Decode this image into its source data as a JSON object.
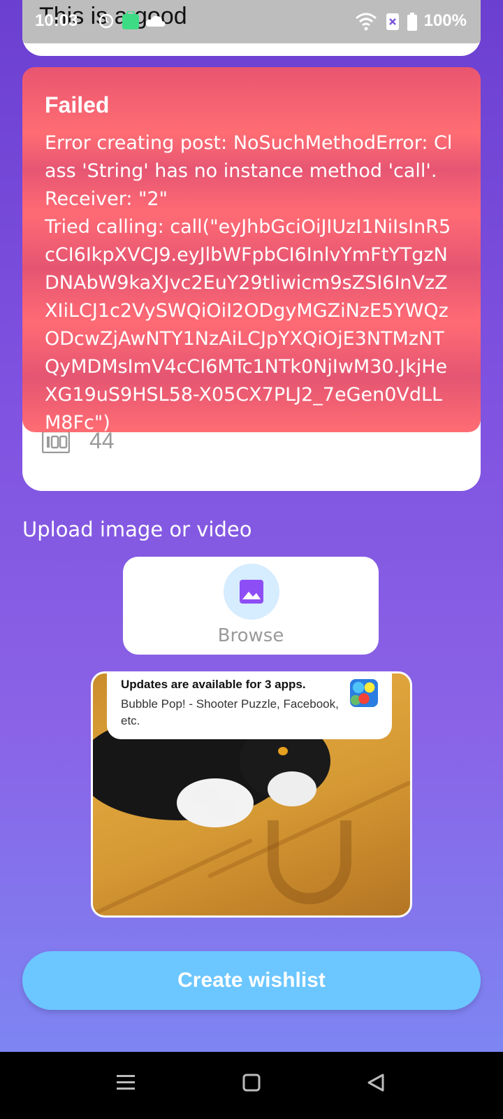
{
  "status_bar": {
    "time": "10:03",
    "battery": "100%",
    "icons": [
      "sync-icon",
      "app-store-icon",
      "cloud-icon",
      "wifi-icon",
      "sim-off-icon",
      "battery-icon"
    ]
  },
  "top_field": {
    "value": "This is a good"
  },
  "error_toast": {
    "title": "Failed",
    "message": "Error creating post: NoSuchMethodError: Class 'String' has no instance method 'call'.\nReceiver: \"2\"\nTried calling: call(\"eyJhbGciOiJIUzI1NiIsInR5cCI6IkpXVCJ9.eyJlbWFpbCI6InlvYmFtYTgzNDNAbW9kaXJvc2EuY29tIiwicm9sZSI6InVzZXIiLCJ1c2VySWQiOiI2ODgyMGZiNzE5YWQzODcwZjAwNTY1NzAiLCJpYXQiOjE3NTMzNTQyMDMsImV4cCI6MTc1NTk0NjIwM30.JkjHeXG19uS9HSL58-X05CX7PLJ2_7eGen0VdLLM8Fc\")",
    "background": "#e85570"
  },
  "form": {
    "count_icon": "100-counter-icon",
    "count_value": "44"
  },
  "upload": {
    "label": "Upload image or video",
    "browse_label": "Browse",
    "browse_icon": "image-icon"
  },
  "notification": {
    "title": "Updates are available for 3 apps.",
    "body": "Bubble Pop! - Shooter Puzzle, Facebook, etc.",
    "app_icon": "bubble-pop-icon"
  },
  "actions": {
    "create_label": "Create wishlist"
  },
  "nav_bar": {
    "icons": [
      "menu-icon",
      "home-icon",
      "back-icon"
    ]
  },
  "colors": {
    "accent": "#6cc6ff",
    "background_top": "#6b3fd0",
    "background_bottom": "#7b8cf5",
    "error": "#e85570"
  }
}
